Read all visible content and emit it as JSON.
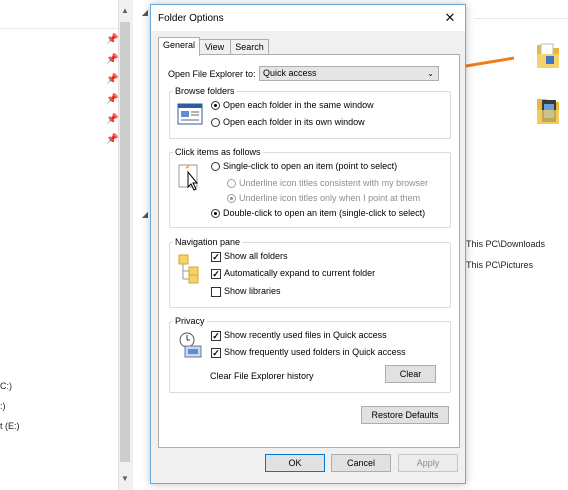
{
  "background": {
    "left_items": [
      "C:)",
      ":)",
      "t (E:)"
    ],
    "right_items": [
      "This PC\\Downloads",
      "This PC\\Pictures"
    ]
  },
  "dialog": {
    "title": "Folder Options",
    "close": "✕",
    "tabs": [
      {
        "label": "General"
      },
      {
        "label": "View"
      },
      {
        "label": "Search"
      }
    ],
    "open_label": "Open File Explorer to:",
    "open_value": "Quick access",
    "browse": {
      "legend": "Browse folders",
      "options": [
        "Open each folder in the same window",
        "Open each folder in its own window"
      ],
      "selected": 0
    },
    "click": {
      "legend": "Click items as follows",
      "single": "Single-click to open an item (point to select)",
      "underline_browser": "Underline icon titles consistent with my browser",
      "underline_point": "Underline icon titles only when I point at them",
      "double": "Double-click to open an item (single-click to select)"
    },
    "nav": {
      "legend": "Navigation pane",
      "show_all": "Show all folders",
      "expand": "Automatically expand to current folder",
      "libraries": "Show libraries"
    },
    "privacy": {
      "legend": "Privacy",
      "recent_files": "Show recently used files in Quick access",
      "frequent_folders": "Show frequently used folders in Quick access",
      "clear_history": "Clear File Explorer history",
      "clear_button": "Clear"
    },
    "restore": "Restore Defaults",
    "ok": "OK",
    "cancel": "Cancel",
    "apply": "Apply"
  },
  "colors": {
    "annotation_arrow": "#f07c1a",
    "accent": "#0078d7"
  }
}
